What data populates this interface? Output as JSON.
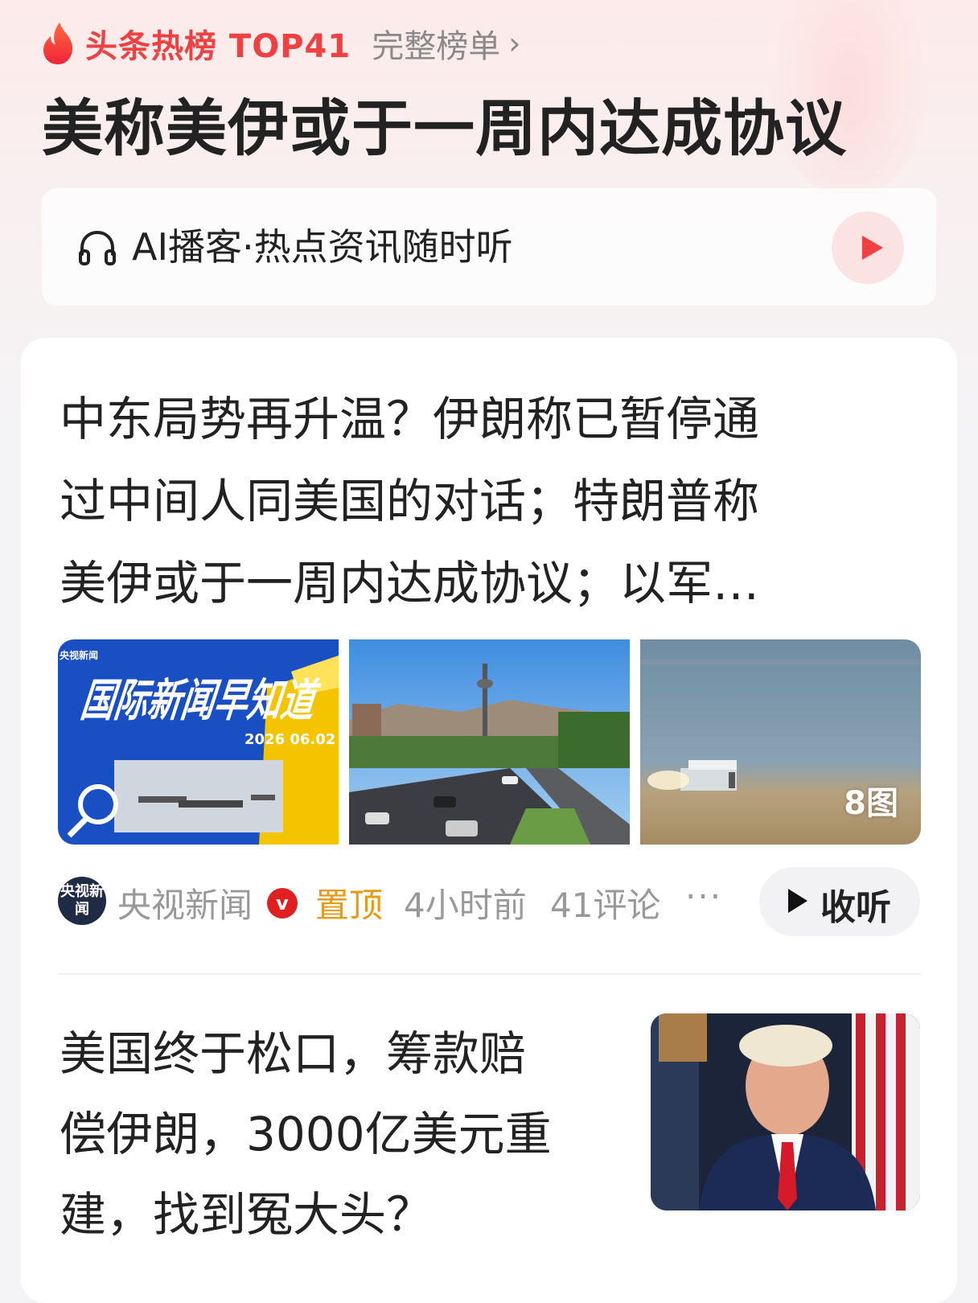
{
  "hot_list": {
    "label": "头条热榜 TOP41",
    "full_list_label": "完整榜单",
    "headline": "美称美伊或于一周内达成协议"
  },
  "podcast": {
    "label": "AI播客·热点资讯随时听"
  },
  "news1": {
    "title_lines": [
      "中东局势再升温？伊朗称已暂停通",
      "过中间人同美国的对话；特朗普称",
      "美伊或于一周内达成协议；以军…"
    ],
    "thumb1_badge": "央视新闻",
    "thumb1_headline": "国际新闻早知道",
    "thumb1_date": "2026 06.02",
    "image_count": "8图",
    "source": "央视新闻",
    "source_avatar_text": "央视新闻",
    "verified_mark": "v",
    "pinned": "置顶",
    "time": "4小时前",
    "comments": "41评论",
    "more": "···",
    "listen_label": "收听"
  },
  "news2": {
    "title_lines": [
      "美国终于松口，筹款赔",
      "偿伊朗，3000亿美元重",
      "建，找到冤大头？"
    ]
  },
  "colors": {
    "accent_red": "#f04142",
    "pinned_orange": "#e79a16",
    "muted_gray": "#999999"
  }
}
